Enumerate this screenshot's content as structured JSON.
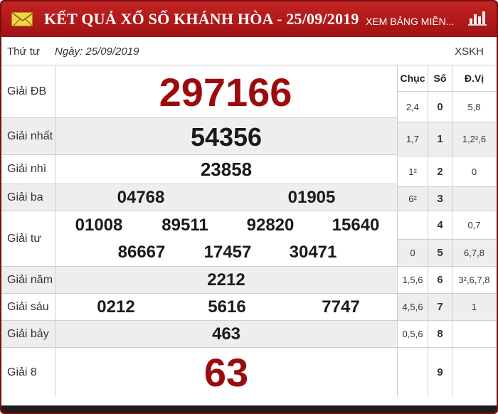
{
  "header": {
    "title": "KẾT QUẢ XỔ SỐ KHÁNH HÒA - 25/09/2019",
    "link_other": "XEM BẢNG MIỀN...",
    "mail_icon": "envelope-icon",
    "chart_icon": "bar-chart-icon"
  },
  "subheader": {
    "day": "Thứ tư",
    "date": "Ngày: 25/09/2019",
    "code": "XSKH"
  },
  "prizes": [
    {
      "label": "Giải ĐB",
      "numbers": [
        "297166"
      ]
    },
    {
      "label": "Giải nhất",
      "numbers": [
        "54356"
      ]
    },
    {
      "label": "Giải nhì",
      "numbers": [
        "23858"
      ]
    },
    {
      "label": "Giải ba",
      "numbers": [
        "04768",
        "01905"
      ]
    },
    {
      "label": "Giải tư",
      "numbers": [
        "01008",
        "89511",
        "92820",
        "15640",
        "86667",
        "17457",
        "30471"
      ]
    },
    {
      "label": "Giải năm",
      "numbers": [
        "2212"
      ]
    },
    {
      "label": "Giải sáu",
      "numbers": [
        "0212",
        "5616",
        "7747"
      ]
    },
    {
      "label": "Giải bảy",
      "numbers": [
        "463"
      ]
    },
    {
      "label": "Giải 8",
      "numbers": [
        "63"
      ]
    }
  ],
  "loto": {
    "headers": [
      "Chục",
      "Số",
      "Đ.Vị"
    ],
    "rows": [
      {
        "chuc": "2,4",
        "so": "0",
        "dvi": "5,8"
      },
      {
        "chuc": "1,7",
        "so": "1",
        "dvi": "1,2²,6"
      },
      {
        "chuc": "1²",
        "so": "2",
        "dvi": "0"
      },
      {
        "chuc": "6²",
        "so": "3",
        "dvi": ""
      },
      {
        "chuc": "",
        "so": "4",
        "dvi": "0,7"
      },
      {
        "chuc": "0",
        "so": "5",
        "dvi": "6,7,8"
      },
      {
        "chuc": "1,5,6",
        "so": "6",
        "dvi": "3²,6,7,8"
      },
      {
        "chuc": "4,5,6",
        "so": "7",
        "dvi": "1"
      },
      {
        "chuc": "0,5,6",
        "so": "8",
        "dvi": ""
      },
      {
        "chuc": "",
        "so": "9",
        "dvi": ""
      }
    ]
  },
  "colors": {
    "header_red": "#b01818",
    "prize_highlight": "#9b0b0b",
    "row_alt": "#eeeeee"
  }
}
